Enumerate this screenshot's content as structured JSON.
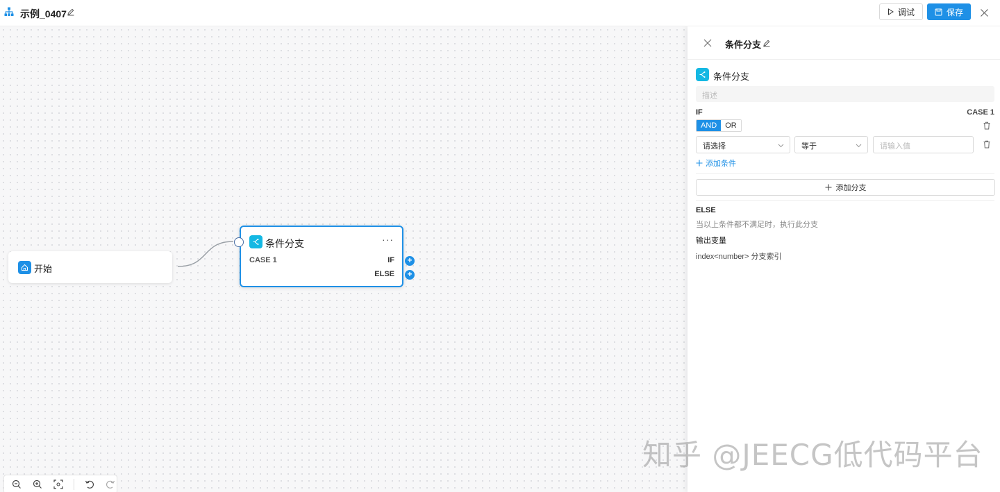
{
  "header": {
    "title": "示例_0407",
    "debug_label": "调试",
    "save_label": "保存"
  },
  "canvas": {
    "start_node": {
      "label": "开始"
    },
    "condition_node": {
      "title": "条件分支",
      "case_label": "CASE 1",
      "if_label": "IF",
      "else_label": "ELSE",
      "more": "···"
    }
  },
  "panel": {
    "title": "条件分支",
    "node_name": "条件分支",
    "description_placeholder": "描述",
    "if_label": "IF",
    "case_label": "CASE 1",
    "logic": {
      "and": "AND",
      "or": "OR",
      "selected": "AND"
    },
    "condition": {
      "field_placeholder": "请选择",
      "operator": "等于",
      "value_placeholder": "请输入值"
    },
    "add_condition_label": "添加条件",
    "add_branch_label": "添加分支",
    "else_label": "ELSE",
    "else_description": "当以上条件都不满足时，执行此分支",
    "output_label": "输出变量",
    "output_variable": "index<number> 分支索引"
  },
  "watermark": "知乎 @JEECG低代码平台",
  "colors": {
    "primary": "#1e90e6",
    "node_icon": "#14b8e3"
  }
}
